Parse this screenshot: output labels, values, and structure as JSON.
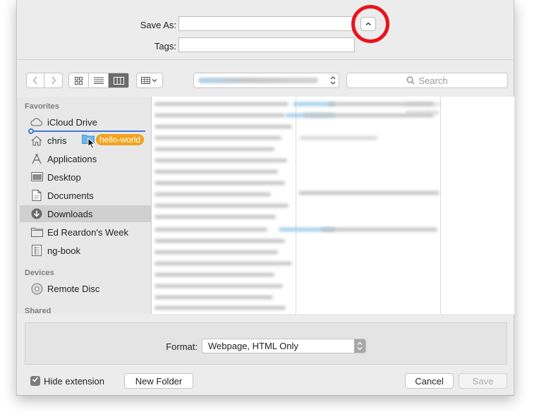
{
  "form": {
    "save_as_label": "Save As:",
    "save_as_value": "",
    "tags_label": "Tags:",
    "tags_value": ""
  },
  "toolbar": {
    "search_placeholder": "Search"
  },
  "sidebar": {
    "favorites_header": "Favorites",
    "favorites": [
      {
        "label": "iCloud Drive",
        "icon": "cloud-icon"
      },
      {
        "label": "chris",
        "icon": "home-icon"
      },
      {
        "label": "Applications",
        "icon": "applications-icon"
      },
      {
        "label": "Desktop",
        "icon": "desktop-icon"
      },
      {
        "label": "Documents",
        "icon": "document-icon"
      },
      {
        "label": "Downloads",
        "icon": "downloads-icon",
        "selected": true
      },
      {
        "label": "Ed Reardon's Week",
        "icon": "folder-icon"
      },
      {
        "label": "ng-book",
        "icon": "archive-icon"
      }
    ],
    "devices_header": "Devices",
    "devices": [
      {
        "label": "Remote Disc",
        "icon": "disc-icon"
      }
    ],
    "shared_header": "Shared",
    "drag_label": "hello-world"
  },
  "format": {
    "label": "Format:",
    "selected": "Webpage, HTML Only"
  },
  "footer": {
    "hide_extension_label": "Hide extension",
    "hide_extension_checked": true,
    "new_folder_label": "New Folder",
    "cancel_label": "Cancel",
    "save_label": "Save"
  },
  "colors": {
    "highlight_ring": "#e8141b",
    "drag_tag": "#f0a31e",
    "drop_indicator": "#3f78d6"
  }
}
